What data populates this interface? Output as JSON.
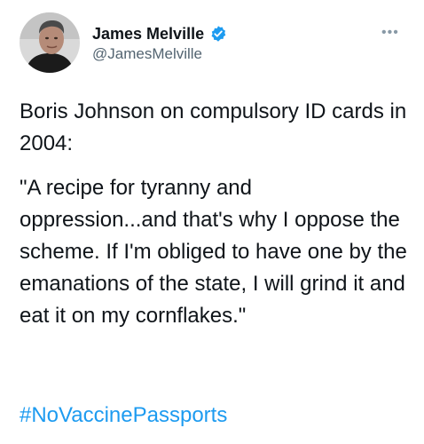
{
  "author": {
    "name": "James Melville",
    "handle": "@JamesMelville",
    "verified": true
  },
  "tweet": {
    "paragraphs": [
      "Boris Johnson on compulsory ID cards in 2004:",
      "\"A recipe for tyranny and oppression...and that's why I oppose the scheme. If I'm obliged to have one by the emanations of the state, I will grind it and eat it on my cornflakes.\""
    ],
    "hashtag": "#NoVaccinePassports"
  },
  "more_menu": "•••",
  "colors": {
    "text": "#0f1419",
    "secondary": "#536471",
    "link": "#1d9bf0"
  },
  "icons": {
    "verified": "verified-badge-icon",
    "more": "more-options-icon"
  }
}
